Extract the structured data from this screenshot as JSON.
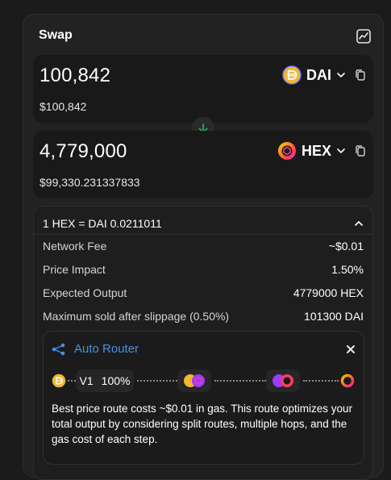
{
  "header": {
    "title": "Swap",
    "chart_icon": "chart-icon"
  },
  "from": {
    "amount": "100,842",
    "usd_value": "$100,842",
    "token": "DAI",
    "token_color": "#f4b731"
  },
  "to": {
    "amount": "4,779,000",
    "usd_value": "$99,330.231337833",
    "token": "HEX",
    "token_color": "#ff2d8a"
  },
  "details": {
    "rate": "1 HEX = DAI 0.0211011",
    "rows": [
      {
        "label": "Network Fee",
        "value": "~$0.01"
      },
      {
        "label": "Price Impact",
        "value": "1.50%"
      },
      {
        "label": "Expected Output",
        "value": "4779000 HEX"
      },
      {
        "label": "Maximum sold after slippage (0.50%)",
        "value": "101300 DAI"
      }
    ]
  },
  "router": {
    "title": "Auto Router",
    "route_version": "V1",
    "route_percent": "100%",
    "description": "Best price route costs ~$0.01 in gas. This route optimizes your total output by considering split routes, multiple hops, and the gas cost of each step."
  },
  "colors": {
    "accent_blue": "#4a90e2",
    "swap_arrow_green": "#27ae60"
  }
}
